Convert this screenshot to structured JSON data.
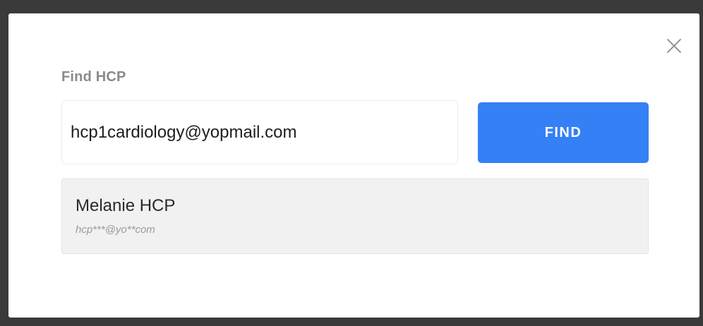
{
  "modal": {
    "title": "Find HCP",
    "close_icon": "close-icon"
  },
  "search": {
    "value": "hcp1cardiology@yopmail.com",
    "placeholder": ""
  },
  "find_button": {
    "label": "FIND",
    "color": "#3580f5"
  },
  "results": [
    {
      "name": "Melanie HCP",
      "email": "hcp***@yo**com"
    }
  ]
}
